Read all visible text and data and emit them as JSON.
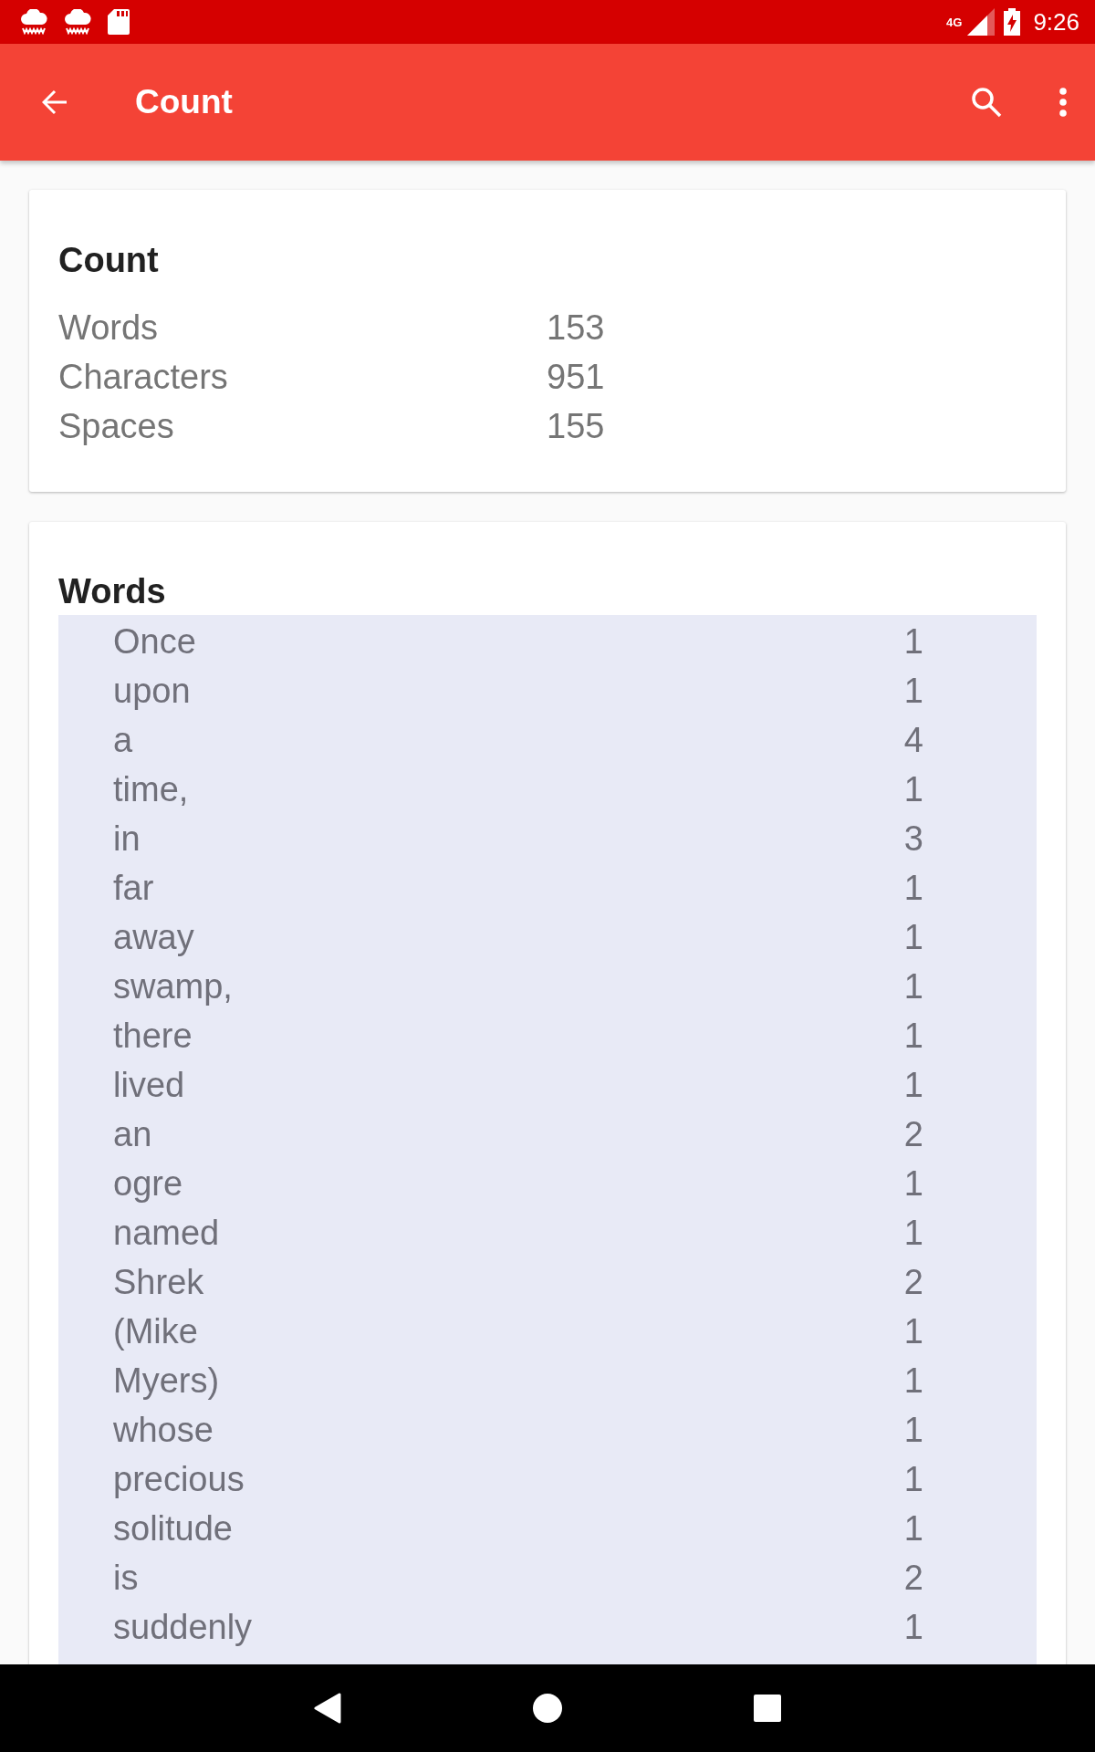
{
  "status_bar": {
    "network": "4G",
    "time": "9:26"
  },
  "app_bar": {
    "title": "Count"
  },
  "count_card": {
    "title": "Count",
    "rows": [
      {
        "label": "Words",
        "value": "153"
      },
      {
        "label": "Characters",
        "value": "951"
      },
      {
        "label": "Spaces",
        "value": "155"
      }
    ]
  },
  "words_card": {
    "title": "Words",
    "rows": [
      {
        "word": "Once",
        "count": "1"
      },
      {
        "word": "upon",
        "count": "1"
      },
      {
        "word": "a",
        "count": "4"
      },
      {
        "word": "time,",
        "count": "1"
      },
      {
        "word": "in",
        "count": "3"
      },
      {
        "word": "far",
        "count": "1"
      },
      {
        "word": "away",
        "count": "1"
      },
      {
        "word": "swamp,",
        "count": "1"
      },
      {
        "word": "there",
        "count": "1"
      },
      {
        "word": "lived",
        "count": "1"
      },
      {
        "word": "an",
        "count": "2"
      },
      {
        "word": "ogre",
        "count": "1"
      },
      {
        "word": "named",
        "count": "1"
      },
      {
        "word": "Shrek",
        "count": "2"
      },
      {
        "word": "(Mike",
        "count": "1"
      },
      {
        "word": "Myers)",
        "count": "1"
      },
      {
        "word": "whose",
        "count": "1"
      },
      {
        "word": "precious",
        "count": "1"
      },
      {
        "word": "solitude",
        "count": "1"
      },
      {
        "word": "is",
        "count": "2"
      },
      {
        "word": "suddenly",
        "count": "1"
      }
    ]
  }
}
